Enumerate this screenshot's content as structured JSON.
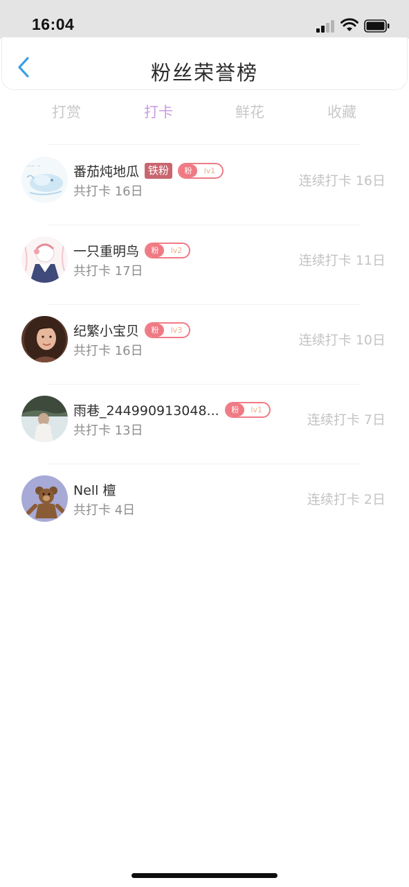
{
  "status_bar": {
    "time": "16:04"
  },
  "header": {
    "title": "粉丝荣誉榜"
  },
  "tabs": [
    {
      "label": "打赏"
    },
    {
      "label": "打卡"
    },
    {
      "label": "鲜花"
    },
    {
      "label": "收藏"
    }
  ],
  "active_tab": "打卡",
  "rows": [
    {
      "name": "番茄炖地瓜",
      "iron_badge": "铁粉",
      "fan_label": "粉",
      "level": "lv1",
      "total": "共打卡 16日",
      "streak": "连续打卡 16日"
    },
    {
      "name": "一只重明鸟",
      "fan_label": "粉",
      "level": "lv2",
      "total": "共打卡 17日",
      "streak": "连续打卡 11日"
    },
    {
      "name": "纪繁小宝贝",
      "fan_label": "粉",
      "level": "lv3",
      "total": "共打卡 16日",
      "streak": "连续打卡 10日"
    },
    {
      "name": "雨巷_244990913048...",
      "fan_label": "粉",
      "level": "lv1",
      "total": "共打卡 13日",
      "streak": "连续打卡 7日"
    },
    {
      "name": "Nell 檀",
      "total": "共打卡 4日",
      "streak": "连续打卡 2日"
    }
  ],
  "colors": {
    "active_tab": "#c99be0",
    "inactive_tab": "#c8c8c8",
    "fan_badge": "#ef7a84",
    "iron_badge": "#c86670",
    "back_arrow": "#3aa0e8"
  }
}
